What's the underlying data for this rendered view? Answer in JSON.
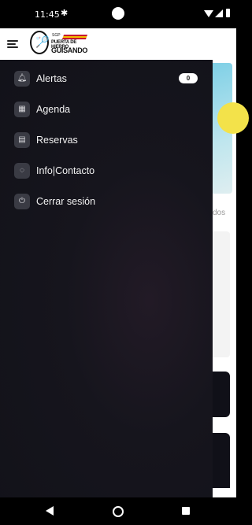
{
  "status_bar": {
    "time": "11:45",
    "settings_icon": "gear-icon"
  },
  "header": {
    "menu_icon": "hamburger-icon",
    "logo": {
      "line_top": "SGP",
      "line_mid": "PUERTA DE HIERRO",
      "line_bottom": "GUISANDO"
    }
  },
  "drawer": {
    "items": [
      {
        "label": "Alertas",
        "icon": "bell-icon",
        "badge": "0"
      },
      {
        "label": "Agenda",
        "icon": "calendar-icon"
      },
      {
        "label": "Reservas",
        "icon": "grid-icon"
      },
      {
        "label": "Info|Contacto",
        "icon": "chat-icon"
      },
      {
        "label": "Cerrar sesión",
        "icon": "power-icon"
      }
    ]
  },
  "background": {
    "partial_text": "dos"
  }
}
